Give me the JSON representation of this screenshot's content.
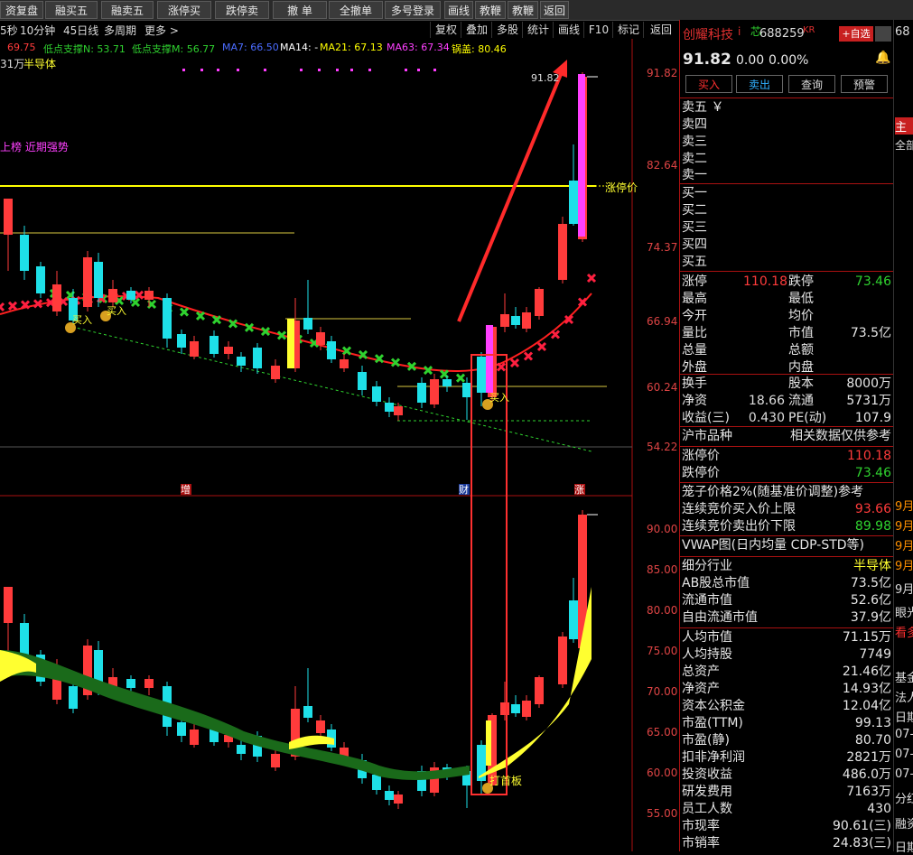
{
  "toolbar": [
    "资复盘",
    "融买五",
    "融卖五",
    "涨停买",
    "跌停卖",
    "撤 单",
    "全撤单",
    "多号登录",
    "画线",
    "教鞭A",
    "教鞭B",
    "返回"
  ],
  "subbar": {
    "items": [
      "5秒",
      "10分钟",
      "45日线",
      "多周期",
      "更多 >"
    ],
    "right": [
      "复权",
      "叠加",
      "多股",
      "统计",
      "画线",
      "F10",
      "标记",
      "返回"
    ]
  },
  "indicators": [
    {
      "text": "69.75",
      "color": "#ff3b3b"
    },
    {
      "text": "低点支撑N: 53.71",
      "color": "#2fd22f"
    },
    {
      "text": "低点支撑M: 56.77",
      "color": "#2fd22f"
    },
    {
      "text": "MA7: 66.50",
      "color": "#4b6cff"
    },
    {
      "text": "MA14: -",
      "color": "#ffffff"
    },
    {
      "text": "MA21: 67.13",
      "color": "#ffff00"
    },
    {
      "text": "MA63: 67.34",
      "color": "#ff40ff"
    },
    {
      "text": "锅盖: 80.46",
      "color": "#ffff00"
    }
  ],
  "chart_left": {
    "volume_label": "31万",
    "sector": "半导体",
    "tag": "上榜 近期强势",
    "limit_label": "涨停价",
    "top_price": "91.82",
    "buy1": "买入",
    "buy2": "买入",
    "buy3": "买入",
    "first_board": "打首板",
    "markers": [
      "增",
      "财",
      "涨"
    ]
  },
  "upper_axis": [
    "91.82",
    "82.64",
    "74.37",
    "66.94",
    "60.24",
    "54.22"
  ],
  "lower_axis": [
    "90.00",
    "85.00",
    "80.00",
    "75.00",
    "70.00",
    "65.00",
    "60.00",
    "55.00"
  ],
  "quote": {
    "name": "创耀科技",
    "flag": "i",
    "core": "芯",
    "code": "688259",
    "kr": "KR",
    "add_btn": "+自选",
    "price": "91.82",
    "chg": "0.00",
    "pct": "0.00%",
    "buttons": [
      "买入",
      "卖出",
      "查询",
      "预警"
    ],
    "sells": [
      "卖五 ￥",
      "卖四",
      "卖三",
      "卖二",
      "卖一"
    ],
    "buys": [
      "买一",
      "买二",
      "买三",
      "买四",
      "买五"
    ],
    "limit_up_lbl": "涨停",
    "limit_up": "110.18",
    "limit_dn_lbl": "跌停",
    "limit_dn": "73.46",
    "stats": [
      [
        "最高",
        "",
        "最低",
        ""
      ],
      [
        "今开",
        "",
        "均价",
        ""
      ],
      [
        "量比",
        "",
        "市值",
        "73.5亿"
      ],
      [
        "总量",
        "",
        "总额",
        ""
      ],
      [
        "外盘",
        "",
        "内盘",
        ""
      ]
    ],
    "stats2": [
      [
        "换手",
        "",
        "股本",
        "8000万"
      ],
      [
        "净资",
        "18.66",
        "流通",
        "5731万"
      ],
      [
        "收益(三)",
        "0.430",
        "PE(动)",
        "107.9"
      ]
    ],
    "market_lbl": "沪市品种",
    "market_note": "相关数据仅供参考",
    "limits": [
      [
        "涨停价",
        "110.18"
      ],
      [
        "跌停价",
        "73.46"
      ]
    ],
    "cage": "笼子价格2%(随基准价调整)参考",
    "auction": [
      [
        "连续竞价买入价上限",
        "93.66"
      ],
      [
        "连续竞价卖出价下限",
        "89.98"
      ]
    ],
    "vwap": "VWAP图(日内均量 CDP-STD等)",
    "fund": [
      [
        "细分行业",
        "半导体"
      ],
      [
        "AB股总市值",
        "73.5亿"
      ],
      [
        "流通市值",
        "52.6亿"
      ],
      [
        "自由流通市值",
        "37.9亿"
      ]
    ],
    "fin": [
      [
        "人均市值",
        "71.15万"
      ],
      [
        "人均持股",
        "7749"
      ],
      [
        "总资产",
        "21.46亿"
      ],
      [
        "净资产",
        "14.93亿"
      ],
      [
        "资本公积金",
        "12.04亿"
      ],
      [
        "市盈(TTM)",
        "99.13"
      ],
      [
        "市盈(静)",
        "80.70"
      ],
      [
        "扣非净利润",
        "2821万"
      ],
      [
        "投资收益",
        "486.0万"
      ],
      [
        "研发费用",
        "7163万"
      ],
      [
        "员工人数",
        "430"
      ],
      [
        "市现率",
        "90.61(三)"
      ],
      [
        "市销率",
        "24.83(三)"
      ]
    ]
  },
  "far": {
    "code": "68",
    "tab1": "主",
    "tab2": "全部",
    "dates": [
      "9月",
      "9月",
      "9月",
      "9月",
      "9月"
    ],
    "items": [
      "眼光",
      "看多",
      "基金",
      "法人",
      "日期",
      "07-",
      "07-",
      "07-",
      "分红",
      "融资",
      "日期"
    ]
  },
  "colors": {
    "up": "#ff3b3b",
    "down": "#1ee0e8",
    "ma": "#ffff00",
    "accent": "#e83030"
  }
}
